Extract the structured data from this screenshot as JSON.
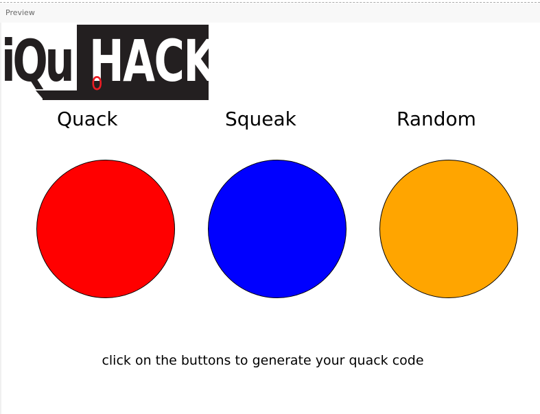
{
  "preview_bar": {
    "label": "Preview"
  },
  "logo": {
    "left_text": "iQu",
    "right_text": "HACK",
    "o_text": "o",
    "colors": {
      "dark": "#231f20",
      "accent": "#ee1c24",
      "light": "#ffffff"
    }
  },
  "buttons": [
    {
      "label": "Quack",
      "color": "#ff0000",
      "icon": "circle-button"
    },
    {
      "label": "Squeak",
      "color": "#0000ff",
      "icon": "circle-button"
    },
    {
      "label": "Random",
      "color": "#ffa500",
      "icon": "circle-button"
    }
  ],
  "hint": {
    "text": "click on the buttons to generate your quack code"
  }
}
